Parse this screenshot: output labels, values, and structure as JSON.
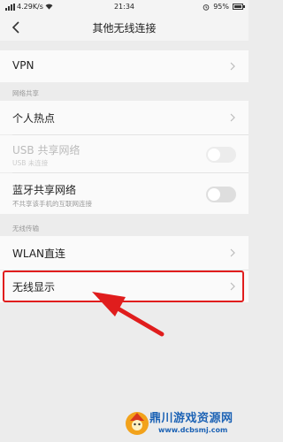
{
  "status_bar": {
    "speed": "4.29K/s",
    "time": "21:34",
    "battery": "95%",
    "battery_level": 0.95
  },
  "header": {
    "title": "其他无线连接",
    "back_icon": "chevron-left-icon"
  },
  "rows": {
    "vpn": {
      "label": "VPN"
    },
    "hotspot": {
      "label": "个人热点"
    },
    "usb": {
      "label": "USB 共享网络",
      "sub": "USB 未连接",
      "enabled": false,
      "checked": false
    },
    "bluetooth": {
      "label": "蓝牙共享网络",
      "sub": "不共享该手机的互联网连接",
      "checked": false
    },
    "wlan_direct": {
      "label": "WLAN直连"
    },
    "wireless_display": {
      "label": "无线显示"
    }
  },
  "sections": {
    "network_sharing": "网络共享",
    "wireless_transfer": "无线传输"
  },
  "annotation": {
    "highlight_color": "#e01d1d"
  },
  "watermark": {
    "title": "鼎川游戏资源网",
    "url": "www.dcbsmj.com",
    "color": "#1d63b5"
  }
}
